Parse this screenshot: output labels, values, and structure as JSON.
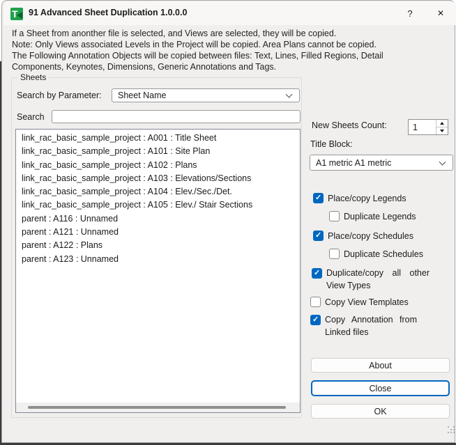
{
  "window": {
    "title": "91 Advanced Sheet Duplication 1.0.0.0",
    "help": "?",
    "close": "✕"
  },
  "intro": {
    "lines": [
      "If a Sheet from anonther file is selected, and Views are selected, they will be copied.",
      "Note: Only Views associated Levels in the Project will be copied. Area Plans cannot be copied.",
      "The Following Annotation Objects will be copied between files: Text, Lines, Filled Regions, Detail",
      "Components, Keynotes, Dimensions, Generic Annotations and Tags."
    ]
  },
  "sheets": {
    "group_label": "Sheets",
    "param_label": "Search by Parameter:",
    "param_value": "Sheet Name",
    "search_label": "Search",
    "search_value": "",
    "items": [
      "link_rac_basic_sample_project : A001 : Title Sheet",
      "link_rac_basic_sample_project : A101 : Site Plan",
      "link_rac_basic_sample_project : A102 : Plans",
      "link_rac_basic_sample_project : A103 : Elevations/Sections",
      "link_rac_basic_sample_project : A104 : Elev./Sec./Det.",
      "link_rac_basic_sample_project : A105 : Elev./ Stair Sections",
      "parent : A116 : Unnamed",
      "parent : A121 : Unnamed",
      "parent : A122 : Plans",
      "parent : A123 : Unnamed"
    ]
  },
  "options": {
    "count_label": "New Sheets Count:",
    "count_value": "1",
    "title_block_label": "Title Block:",
    "title_block_value": "A1 metric A1 metric",
    "checkboxes": [
      {
        "label": "Place/copy Legends",
        "checked": true
      },
      {
        "label": "Duplicate Legends",
        "checked": false
      },
      {
        "label": "Place/copy Schedules",
        "checked": true
      },
      {
        "label": "Duplicate Schedules",
        "checked": false
      },
      {
        "label": "Duplicate/copy all other View Types",
        "checked": true
      },
      {
        "label": "Copy View Templates",
        "checked": false
      },
      {
        "label": "Copy Annotation from Linked files",
        "checked": true
      }
    ]
  },
  "buttons": {
    "about": "About",
    "close": "Close",
    "ok": "OK"
  },
  "colors": {
    "accent": "#0067c0",
    "icon_green": "#1fa14b",
    "window_bg": "#f0efee"
  }
}
